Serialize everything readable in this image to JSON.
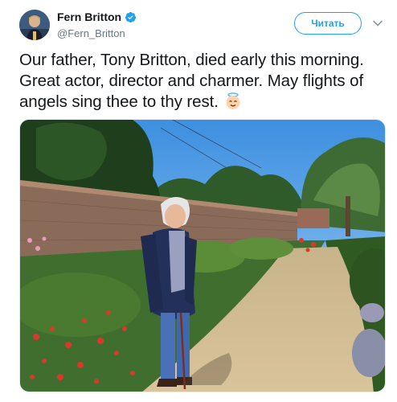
{
  "author": {
    "display_name": "Fern Britton",
    "handle": "@Fern_Britton",
    "verified": true,
    "avatar_icon": "profile-photo"
  },
  "actions": {
    "follow_label": "Читать",
    "more_icon": "chevron-down-icon"
  },
  "tweet": {
    "text": "Our father, Tony Britton, died early this morning. Great actor, director and charmer. May flights of angels sing thee to thy rest.",
    "emoji": "angel-emoji"
  },
  "media": {
    "description_icon": "garden-photo"
  },
  "colors": {
    "accent": "#1da1f2",
    "text": "#14171a",
    "secondary": "#657786"
  }
}
